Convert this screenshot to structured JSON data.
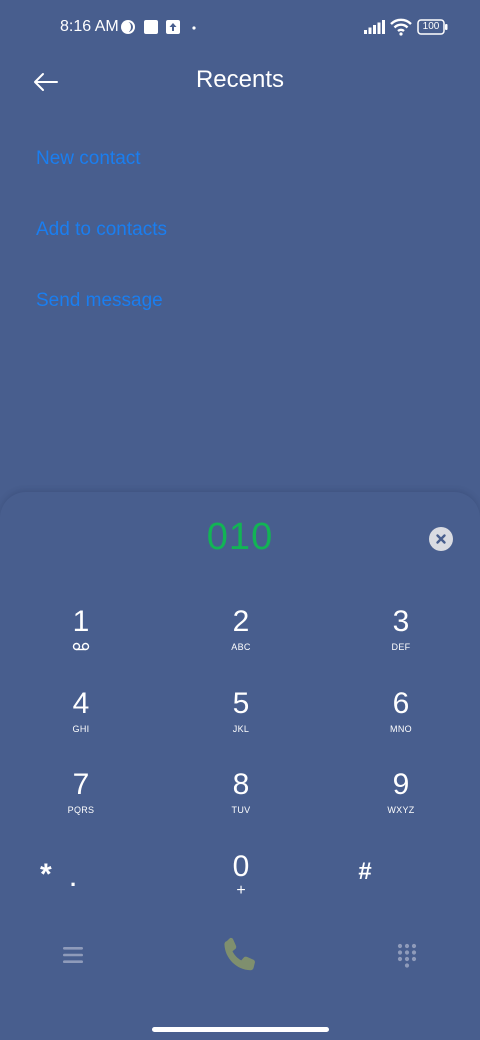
{
  "status_bar": {
    "time": "8:16 AM",
    "battery": "100",
    "icons": [
      "moon-icon",
      "square-notification-icon",
      "upload-icon",
      "dot-icon",
      "signal-icon",
      "wifi-icon",
      "battery-icon"
    ]
  },
  "header": {
    "title": "Recents",
    "back_icon": "back-arrow-icon"
  },
  "actions": [
    {
      "label": "New contact"
    },
    {
      "label": "Add to contacts"
    },
    {
      "label": "Send message"
    }
  ],
  "dialpad": {
    "number": "010",
    "keys": [
      {
        "digit": "1",
        "letters": "",
        "symbol": "voicemail-icon"
      },
      {
        "digit": "2",
        "letters": "ABC"
      },
      {
        "digit": "3",
        "letters": "DEF"
      },
      {
        "digit": "4",
        "letters": "GHI"
      },
      {
        "digit": "5",
        "letters": "JKL"
      },
      {
        "digit": "6",
        "letters": "MNO"
      },
      {
        "digit": "7",
        "letters": "PQRS"
      },
      {
        "digit": "8",
        "letters": "TUV"
      },
      {
        "digit": "9",
        "letters": "WXYZ"
      },
      {
        "digit": "*",
        "letters": "."
      },
      {
        "digit": "0",
        "letters": "+"
      },
      {
        "digit": "#",
        "letters": ""
      }
    ]
  },
  "bottom_bar": {
    "icons": [
      "menu-icon",
      "phone-icon",
      "dialpad-icon"
    ]
  },
  "colors": {
    "background": "#485e8e",
    "link": "#1a7ef0",
    "number": "#12b455",
    "call": "#7f8f6e"
  }
}
